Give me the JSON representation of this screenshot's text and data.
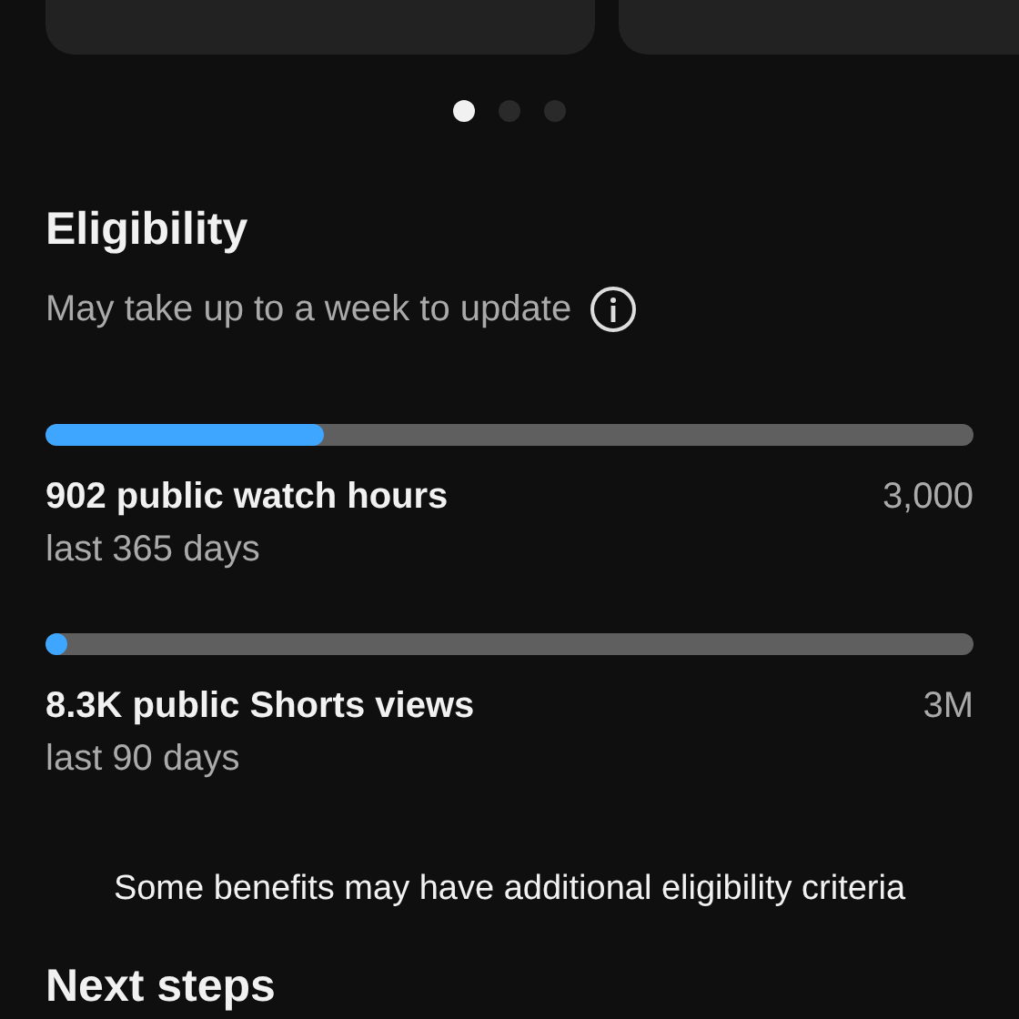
{
  "carousel": {
    "cards": [
      {
        "kind": "card"
      },
      {
        "kind": "card"
      }
    ],
    "dots": [
      {
        "selected": true
      },
      {
        "selected": false
      },
      {
        "selected": false
      }
    ]
  },
  "eligibility": {
    "title": "Eligibility",
    "subtitle": "May take up to a week to update",
    "metrics": [
      {
        "label": "902 public watch hours",
        "target": "3,000",
        "period": "last 365 days",
        "level": 0.3
      },
      {
        "label": "8.3K public Shorts views",
        "target": "3M",
        "period": "last 90 days",
        "level": 0.02
      }
    ],
    "note": "Some benefits may have additional eligibility criteria"
  },
  "next_steps": {
    "title": "Next steps"
  }
}
